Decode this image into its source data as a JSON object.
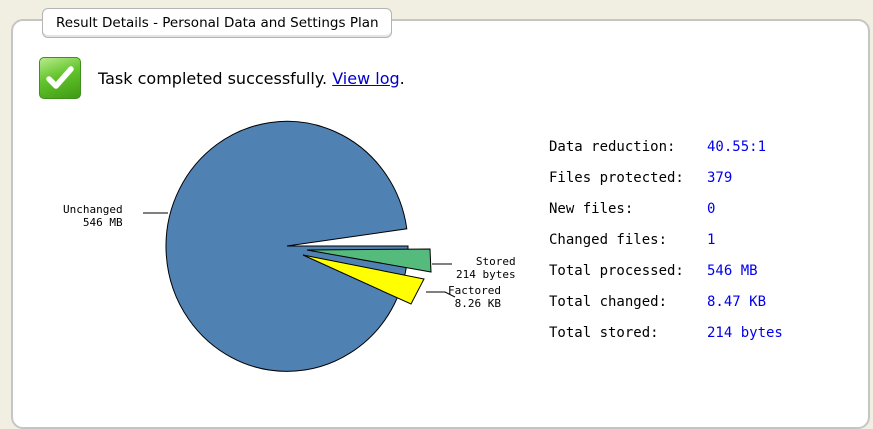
{
  "panel": {
    "title": "Result Details - Personal Data and Settings Plan"
  },
  "status": {
    "icon": "check-icon",
    "text": "Task completed successfully. ",
    "link": "View log",
    "trailing": "."
  },
  "chart_data": {
    "type": "pie",
    "slices": [
      {
        "label": "Unchanged",
        "value_text": "546 MB",
        "value_mb": 546,
        "color": "#4f81b3"
      },
      {
        "label": "Stored",
        "value_text": "214 bytes",
        "value_mb": 0.000214,
        "color": "#55bb7d"
      },
      {
        "label": "Factored",
        "value_text": "8.26 KB",
        "value_mb": 0.00826,
        "color": "#ffff00"
      }
    ]
  },
  "stats": [
    {
      "label": "Data reduction:",
      "value": "40.55:1"
    },
    {
      "label": "Files protected:",
      "value": "379"
    },
    {
      "label": "New files:",
      "value": "0"
    },
    {
      "label": "Changed files:",
      "value": "1"
    },
    {
      "label": "Total processed:",
      "value": "546 MB"
    },
    {
      "label": "Total changed:",
      "value": "8.47 KB"
    },
    {
      "label": "Total stored:",
      "value": "214 bytes"
    }
  ],
  "colors": {
    "page_background": "#f1efe2",
    "panel_background": "#ffffff",
    "link": "#0000cc",
    "stat_value": "#0000ee"
  }
}
